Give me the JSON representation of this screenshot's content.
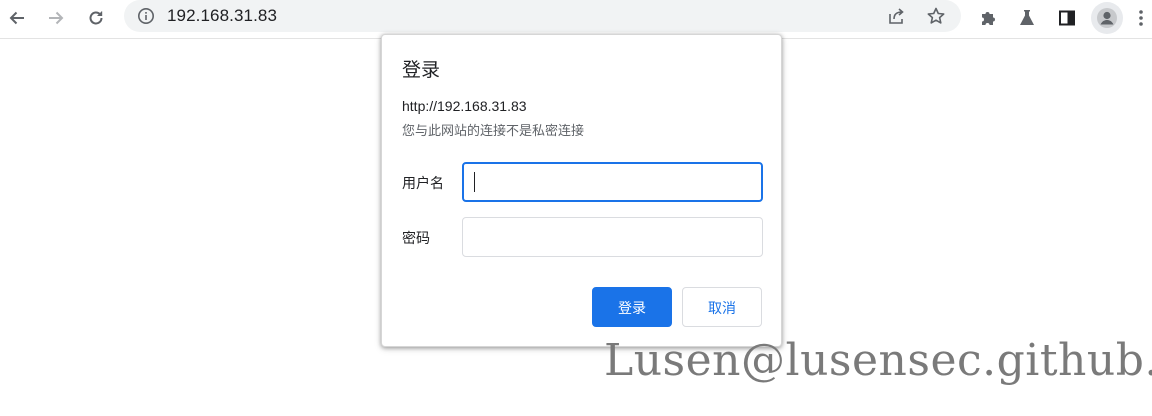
{
  "browser": {
    "address_bar": {
      "url": "192.168.31.83"
    },
    "icons": {
      "back": "arrow-left-icon",
      "forward": "arrow-right-icon",
      "reload": "reload-icon",
      "site_info": "info-icon",
      "share": "share-icon",
      "bookmark": "star-icon",
      "extensions": "puzzle-icon",
      "labs": "flask-icon",
      "side_panel": "side-panel-icon",
      "profile": "avatar-icon",
      "menu": "kebab-menu-icon"
    }
  },
  "dialog": {
    "title": "登录",
    "url": "http://192.168.31.83",
    "warning": "您与此网站的连接不是私密连接",
    "username_label": "用户名",
    "username_value": "",
    "password_label": "密码",
    "password_value": "",
    "login_button": "登录",
    "cancel_button": "取消"
  },
  "watermark": "Lusen@lusensec.github.io",
  "colors": {
    "accent": "#1a73e8",
    "omnibox_bg": "#f1f3f4",
    "watermark": "#7a7a7a"
  }
}
